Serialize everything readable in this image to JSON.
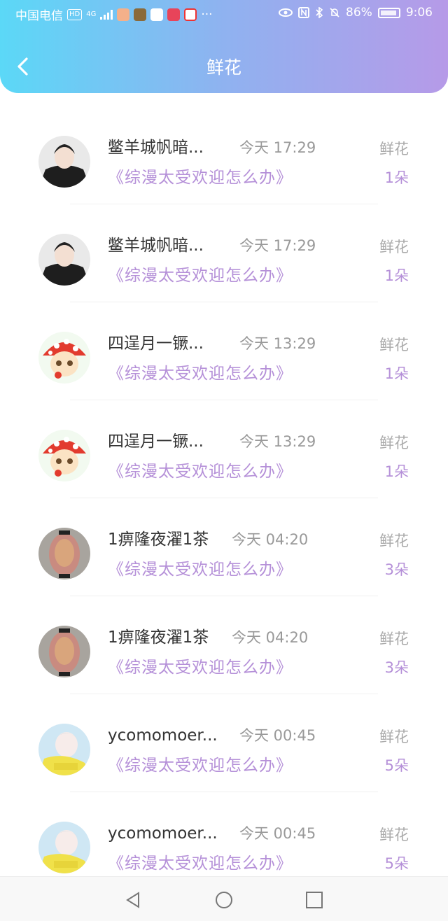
{
  "status_bar": {
    "carrier": "中国电信",
    "hd_badge": "HD",
    "network": "4G",
    "battery_percent": "86%",
    "time": "9:06",
    "more": "···"
  },
  "header": {
    "title": "鲜花",
    "back_icon": "chevron-left-icon"
  },
  "items": [
    {
      "name": "鳖羊城帆暗...",
      "time": "今天 17:29",
      "book": "《综漫太受欢迎怎么办》",
      "gift": "鲜花",
      "count": "1朵",
      "avatar": "avatar-black-hood"
    },
    {
      "name": "鳖羊城帆暗...",
      "time": "今天 17:29",
      "book": "《综漫太受欢迎怎么办》",
      "gift": "鲜花",
      "count": "1朵",
      "avatar": "avatar-black-hood"
    },
    {
      "name": "四逞月一镢...",
      "time": "今天 13:29",
      "book": "《综漫太受欢迎怎么办》",
      "gift": "鲜花",
      "count": "1朵",
      "avatar": "avatar-mushroom-girl"
    },
    {
      "name": "四逞月一镢...",
      "time": "今天 13:29",
      "book": "《综漫太受欢迎怎么办》",
      "gift": "鲜花",
      "count": "1朵",
      "avatar": "avatar-mushroom-girl"
    },
    {
      "name": "1痹隆夜濯1茶",
      "time": "今天 04:20",
      "book": "《综漫太受欢迎怎么办》",
      "gift": "鲜花",
      "count": "3朵",
      "avatar": "avatar-painted-vase"
    },
    {
      "name": "1痹隆夜濯1茶",
      "time": "今天 04:20",
      "book": "《综漫太受欢迎怎么办》",
      "gift": "鲜花",
      "count": "3朵",
      "avatar": "avatar-painted-vase"
    },
    {
      "name": "ycomomoer...",
      "time": "今天 00:45",
      "book": "《综漫太受欢迎怎么办》",
      "gift": "鲜花",
      "count": "5朵",
      "avatar": "avatar-anime-boy"
    },
    {
      "name": "ycomomoer...",
      "time": "今天 00:45",
      "book": "《综漫太受欢迎怎么办》",
      "gift": "鲜花",
      "count": "5朵",
      "avatar": "avatar-anime-boy"
    }
  ],
  "nav": {
    "back": "triangle-back-icon",
    "home": "circle-home-icon",
    "recents": "square-recents-icon"
  },
  "colors": {
    "header_start": "#5bd8f7",
    "header_end": "#b69ae8",
    "accent": "#b590d8"
  }
}
